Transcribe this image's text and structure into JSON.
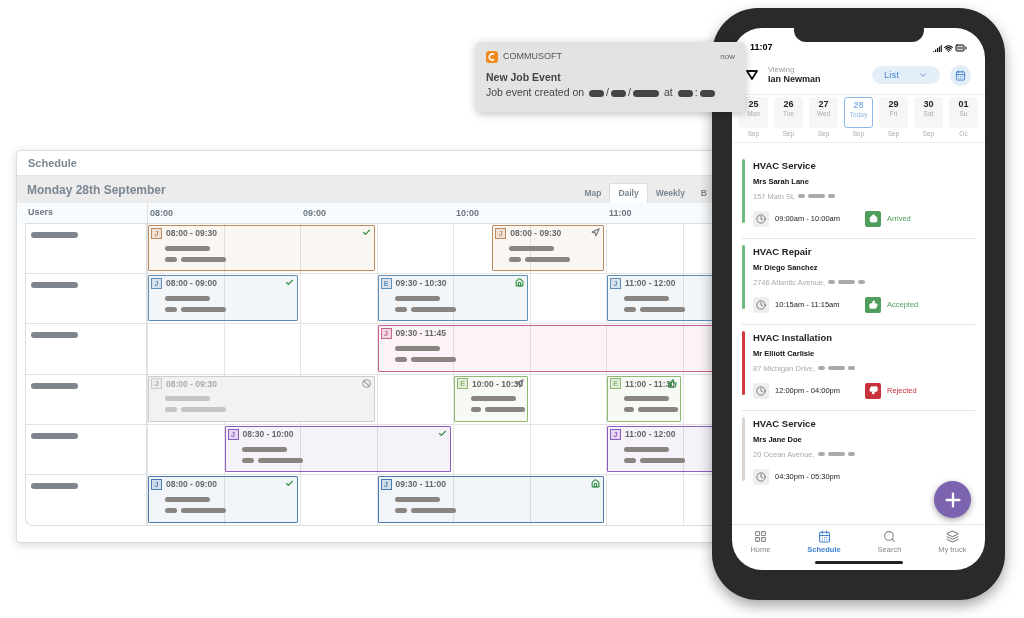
{
  "notification": {
    "app": "COMMUSOFT",
    "time": "now",
    "title": "New Job Event",
    "message": "Job event created on",
    "date_separators": [
      "/",
      "/"
    ],
    "at": "at",
    "time_separator": ":"
  },
  "schedule": {
    "title": "Schedule",
    "date": "Monday 28th September",
    "tabs": [
      {
        "label": "Map",
        "selected": false
      },
      {
        "label": "Daily",
        "selected": true
      },
      {
        "label": "Weekly",
        "selected": false
      },
      {
        "label": "B",
        "selected": false
      }
    ],
    "users_header": "Users",
    "hours": [
      "08:00",
      "09:00",
      "10:00",
      "11:00"
    ],
    "rows": [
      {
        "events": [
          {
            "type": "J",
            "time": "08:00 - 09:30",
            "kind": "done",
            "color": "#c08a5c",
            "disabled": false
          },
          {
            "type": "J",
            "time": "08:00 - 09:30",
            "kind": "en_route",
            "color": "#c08a5c",
            "disabled": false
          }
        ]
      },
      {
        "events": [
          {
            "type": "J",
            "time": "08:00 - 09:00",
            "kind": "done",
            "color": "#5f8db8",
            "disabled": false
          },
          {
            "type": "E",
            "time": "09:30 - 10:30",
            "kind": "arrived",
            "color": "#5f8db8",
            "disabled": false
          },
          {
            "type": "J",
            "time": "11:00 - 12:00",
            "color": "#5f8db8",
            "disabled": false
          }
        ]
      },
      {
        "events": [
          {
            "type": "J",
            "time": "09:30 - 11:45",
            "color": "#c6628f",
            "disabled": false
          }
        ]
      },
      {
        "events": [
          {
            "type": "J",
            "time": "08:00 - 09:30",
            "kind": "cancelled",
            "color": "#cccccc",
            "disabled": true
          },
          {
            "type": "E",
            "time": "10:00 - 10:30",
            "kind": "en_route",
            "color": "#8fb870",
            "disabled": false
          },
          {
            "type": "E",
            "time": "11:00 - 11:30",
            "kind": "accepted",
            "color": "#8fb870",
            "disabled": false
          }
        ]
      },
      {
        "events": [
          {
            "type": "J",
            "time": "08:30 - 10:00",
            "kind": "done",
            "color": "#8e5cc0",
            "disabled": false
          },
          {
            "type": "J",
            "time": "11:00 - 12:00",
            "color": "#8e5cc0",
            "disabled": false
          }
        ]
      },
      {
        "events": [
          {
            "type": "J",
            "time": "08:00 - 09:00",
            "kind": "done",
            "color": "#4a7bb0",
            "disabled": false
          },
          {
            "type": "J",
            "time": "09:30 - 11:00",
            "kind": "arrived",
            "color": "#4a7bb0",
            "disabled": false
          }
        ]
      }
    ]
  },
  "phone": {
    "status_time": "11:07",
    "viewing_label": "Viewing",
    "viewer": "Ian Newman",
    "view_mode": "List",
    "days": [
      {
        "day": "25",
        "weekday": "Mon",
        "month": "Sep",
        "selected": false
      },
      {
        "day": "26",
        "weekday": "Tue",
        "month": "Sep",
        "selected": false
      },
      {
        "day": "27",
        "weekday": "Wed",
        "month": "Sep",
        "selected": false
      },
      {
        "day": "28",
        "weekday": "Today",
        "month": "Sep",
        "selected": true
      },
      {
        "day": "29",
        "weekday": "Fri",
        "month": "Sep",
        "selected": false
      },
      {
        "day": "30",
        "weekday": "Sat",
        "month": "Sep",
        "selected": false
      },
      {
        "day": "01",
        "weekday": "Su",
        "month": "Oc",
        "selected": false
      }
    ],
    "jobs": [
      {
        "title": "HVAC Service",
        "customer": "Mrs Sarah Lane",
        "address": "157 Main St,",
        "time": "09:00am - 10:00am",
        "kind": "arrived",
        "status_label": "Arrived",
        "color": "#6dbb7d"
      },
      {
        "title": "HVAC Repair",
        "customer": "Mr Diego Sanchez",
        "address": "2746 Atlantic Avenue,",
        "time": "10:15am - 11:15am",
        "kind": "accepted",
        "status_label": "Accepted",
        "color": "#6dbb7d"
      },
      {
        "title": "HVAC Installation",
        "customer": "Mr Elliott Carlisle",
        "address": "87 Michigan Drive,",
        "time": "12:00pm - 04:00pm",
        "kind": "rejected",
        "status_label": "Rejected",
        "color": "#d0393f"
      },
      {
        "title": "HVAC Service",
        "customer": "Mrs Jane Doe",
        "address": "20 Ocean Avenue,",
        "time": "04:30pm - 05:30pm",
        "color": "#ddd5cf"
      }
    ],
    "nav": [
      {
        "label": "Home",
        "kind": "home",
        "selected": false
      },
      {
        "label": "Schedule",
        "kind": "schedule",
        "selected": true
      },
      {
        "label": "Search",
        "kind": "search",
        "selected": false
      },
      {
        "label": "My truck",
        "kind": "truck",
        "selected": false
      }
    ]
  }
}
